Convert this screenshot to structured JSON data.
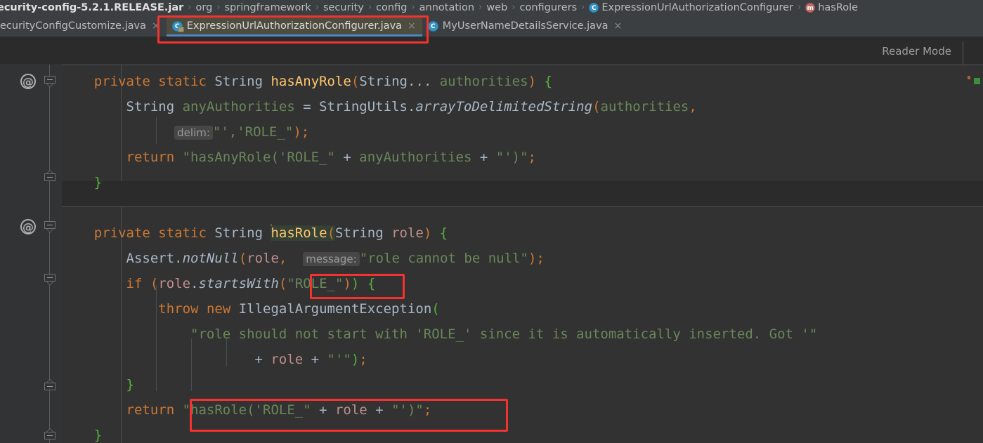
{
  "window": {
    "app": "IntelliJ IDEA",
    "theme_background": "#2b2b2b",
    "accent_blue": "#4a88c7",
    "annotation_color": "#f5322e"
  },
  "breadcrumb": {
    "items": [
      {
        "label": "ecurity-config-5.2.1.RELEASE.jar",
        "icon": "jar-icon",
        "kind": "jar"
      },
      {
        "label": "org",
        "icon": "",
        "kind": "package"
      },
      {
        "label": "springframework",
        "icon": "",
        "kind": "package"
      },
      {
        "label": "security",
        "icon": "",
        "kind": "package"
      },
      {
        "label": "config",
        "icon": "",
        "kind": "package"
      },
      {
        "label": "annotation",
        "icon": "",
        "kind": "package"
      },
      {
        "label": "web",
        "icon": "",
        "kind": "package"
      },
      {
        "label": "configurers",
        "icon": "",
        "kind": "package"
      },
      {
        "label": "ExpressionUrlAuthorizationConfigurer",
        "icon": "class-icon",
        "kind": "class"
      },
      {
        "label": "hasRole",
        "icon": "method-icon",
        "kind": "method"
      }
    ],
    "separator": "›"
  },
  "tabs": [
    {
      "label": "ecurityConfigCustomize.java",
      "icon": "class-icon",
      "active": false,
      "close": "×",
      "has_icon": false
    },
    {
      "label": "ExpressionUrlAuthorizationConfigurer.java",
      "icon": "class-icon-locked",
      "active": true,
      "close": "×",
      "has_icon": true
    },
    {
      "label": "MyUserNameDetailsService.java",
      "icon": "class-icon",
      "active": false,
      "close": "×",
      "has_icon": true
    }
  ],
  "toolbar": {
    "reader_mode_label": "Reader Mode"
  },
  "editor": {
    "language": "Java",
    "font": "monospace",
    "caret_on_token": "hasRole",
    "highlighted_identifier": "hasRole(",
    "gutter_annotation_icon": "at-sign-icon",
    "parameter_hints": [
      "delim:",
      "message:"
    ],
    "code_lines": [
      {
        "id": 1,
        "indent": 0,
        "text": "    private static String hasAnyRole(String... authorities) {",
        "tokens": [
          {
            "t": "    ",
            "c": "plain"
          },
          {
            "t": "private",
            "c": "kw"
          },
          {
            "t": " ",
            "c": "plain"
          },
          {
            "t": "static",
            "c": "kw"
          },
          {
            "t": " ",
            "c": "plain"
          },
          {
            "t": "String",
            "c": "type"
          },
          {
            "t": " ",
            "c": "plain"
          },
          {
            "t": "hasAnyRole",
            "c": "meth"
          },
          {
            "t": "(",
            "c": "paren"
          },
          {
            "t": "String",
            "c": "type"
          },
          {
            "t": "... ",
            "c": "plain"
          },
          {
            "t": "authorities",
            "c": "param"
          },
          {
            "t": ")",
            "c": "paren"
          },
          {
            "t": " ",
            "c": "plain"
          },
          {
            "t": "{",
            "c": "brace"
          }
        ]
      },
      {
        "id": 2,
        "indent": 1,
        "text": "        String anyAuthorities = StringUtils.arrayToDelimitedString(authorities,",
        "tokens": [
          {
            "t": "        ",
            "c": "plain"
          },
          {
            "t": "String",
            "c": "type"
          },
          {
            "t": " ",
            "c": "plain"
          },
          {
            "t": "anyAuthorities",
            "c": "param"
          },
          {
            "t": " = ",
            "c": "plain"
          },
          {
            "t": "StringUtils",
            "c": "type"
          },
          {
            "t": ".",
            "c": "plain"
          },
          {
            "t": "arrayToDelimitedString",
            "c": "methi"
          },
          {
            "t": "(",
            "c": "paren"
          },
          {
            "t": "authorities",
            "c": "param"
          },
          {
            "t": ",",
            "c": "paren"
          }
        ]
      },
      {
        "id": 3,
        "indent": 3,
        "hint": "delim:",
        "text": "                delim: \"','ROLE_\");",
        "tokens": [
          {
            "t": "\"','ROLE_\"",
            "c": "str"
          },
          {
            "t": ")",
            "c": "paren"
          },
          {
            "t": ";",
            "c": "kw"
          }
        ]
      },
      {
        "id": 4,
        "indent": 1,
        "text": "        return \"hasAnyRole('ROLE_\" + anyAuthorities + \"')\";",
        "tokens": [
          {
            "t": "        ",
            "c": "plain"
          },
          {
            "t": "return",
            "c": "kw"
          },
          {
            "t": " ",
            "c": "plain"
          },
          {
            "t": "\"hasAnyRole('ROLE_\"",
            "c": "str"
          },
          {
            "t": " + ",
            "c": "plain"
          },
          {
            "t": "anyAuthorities",
            "c": "param"
          },
          {
            "t": " + ",
            "c": "plain"
          },
          {
            "t": "\"')\"",
            "c": "str"
          },
          {
            "t": ";",
            "c": "kw"
          }
        ]
      },
      {
        "id": 5,
        "indent": 0,
        "text": "    }",
        "tokens": [
          {
            "t": "    ",
            "c": "plain"
          },
          {
            "t": "}",
            "c": "brace"
          }
        ]
      },
      {
        "id": 6,
        "indent": 0,
        "text": "",
        "tokens": []
      },
      {
        "id": 7,
        "indent": 0,
        "text": "    private static String hasRole(String role) {",
        "tokens": [
          {
            "t": "    ",
            "c": "plain"
          },
          {
            "t": "private",
            "c": "kw"
          },
          {
            "t": " ",
            "c": "plain"
          },
          {
            "t": "static",
            "c": "kw"
          },
          {
            "t": " ",
            "c": "plain"
          },
          {
            "t": "String",
            "c": "type"
          },
          {
            "t": " ",
            "c": "plain"
          },
          {
            "t": "hasRole",
            "c": "meth"
          },
          {
            "t": "(",
            "c": "paren"
          },
          {
            "t": "String",
            "c": "type"
          },
          {
            "t": " ",
            "c": "plain"
          },
          {
            "t": "role",
            "c": "varname"
          },
          {
            "t": ")",
            "c": "paren"
          },
          {
            "t": " ",
            "c": "plain"
          },
          {
            "t": "{",
            "c": "brace"
          }
        ]
      },
      {
        "id": 8,
        "indent": 1,
        "hint": "message:",
        "text": "        Assert.notNull(role, message: \"role cannot be null\");",
        "tokens": []
      },
      {
        "id": 9,
        "indent": 1,
        "text": "        if (role.startsWith(\"ROLE_\")) {",
        "tokens": []
      },
      {
        "id": 10,
        "indent": 2,
        "text": "            throw new IllegalArgumentException(",
        "tokens": []
      },
      {
        "id": 11,
        "indent": 4,
        "text": "                    \"role should not start with 'ROLE_' since it is automatically inserted. Got '\"",
        "tokens": []
      },
      {
        "id": 12,
        "indent": 5,
        "text": "                            + role + \"'\");",
        "tokens": []
      },
      {
        "id": 13,
        "indent": 1,
        "text": "        }",
        "tokens": []
      },
      {
        "id": 14,
        "indent": 1,
        "text": "        return \"hasRole('ROLE_\" + role + \"')\";",
        "tokens": []
      },
      {
        "id": 15,
        "indent": 0,
        "text": "    }",
        "tokens": []
      }
    ],
    "annotations": [
      {
        "name": "tab-highlight-box",
        "target": "ExpressionUrlAuthorizationConfigurer.java tab"
      },
      {
        "name": "startswith-arg-box",
        "target": "(\"ROLE_\"))"
      },
      {
        "name": "return-string-box",
        "target": "\"hasRole('ROLE_\" + role + \"')\";"
      }
    ]
  }
}
